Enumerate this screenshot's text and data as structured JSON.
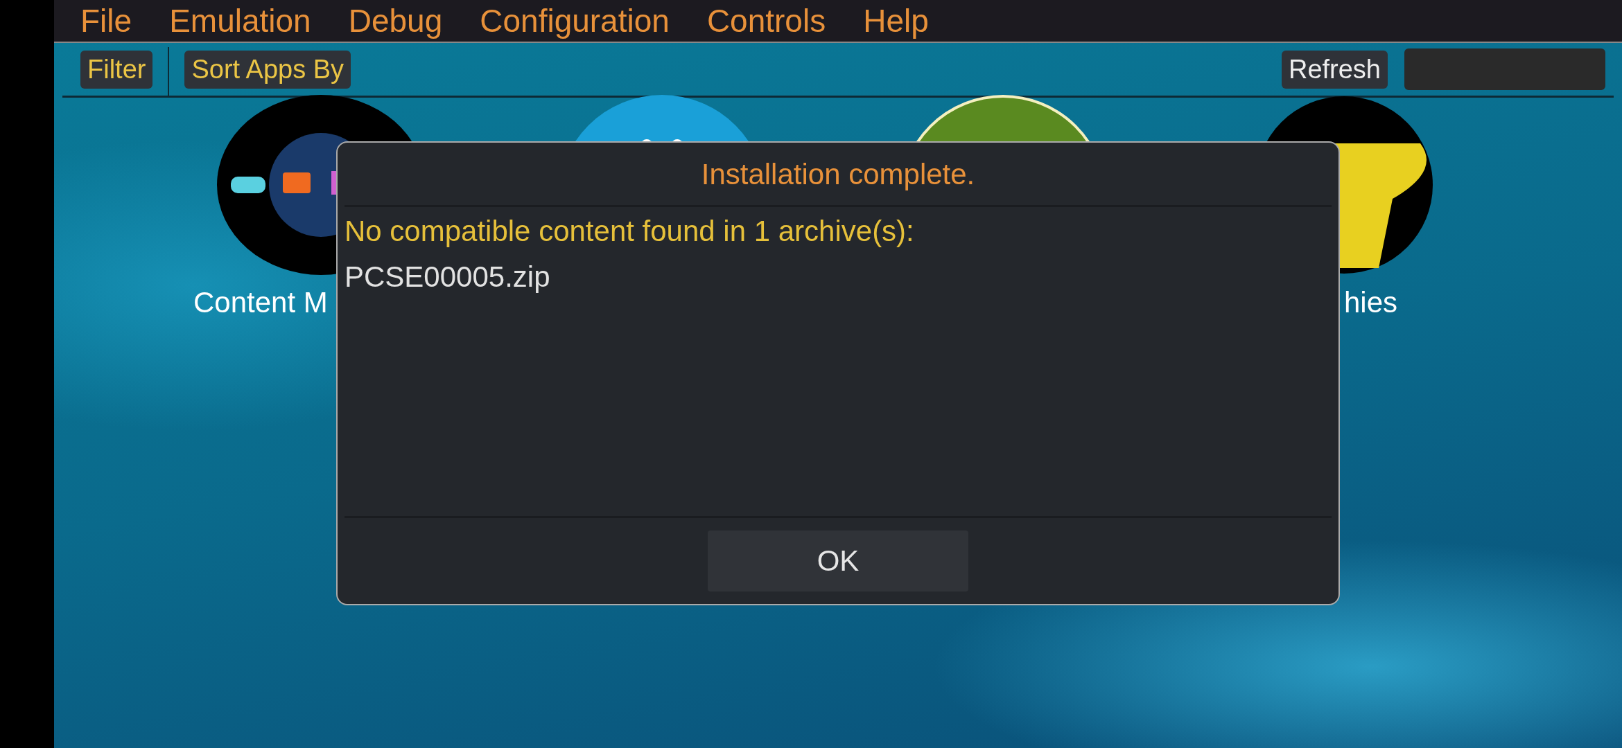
{
  "menu": [
    "File",
    "Emulation",
    "Debug",
    "Configuration",
    "Controls",
    "Help"
  ],
  "toolbar": {
    "filter": "Filter",
    "sort": "Sort Apps By",
    "refresh": "Refresh"
  },
  "apps": [
    {
      "kind": "media",
      "label": "Content M"
    },
    {
      "kind": "chat"
    },
    {
      "kind": "store"
    },
    {
      "kind": "trophy",
      "label": "hies"
    }
  ],
  "dialog": {
    "title": "Installation complete.",
    "message": "No compatible content found in 1 archive(s):",
    "files": [
      "PCSE00005.zip"
    ],
    "buttons": [
      "OK"
    ]
  }
}
